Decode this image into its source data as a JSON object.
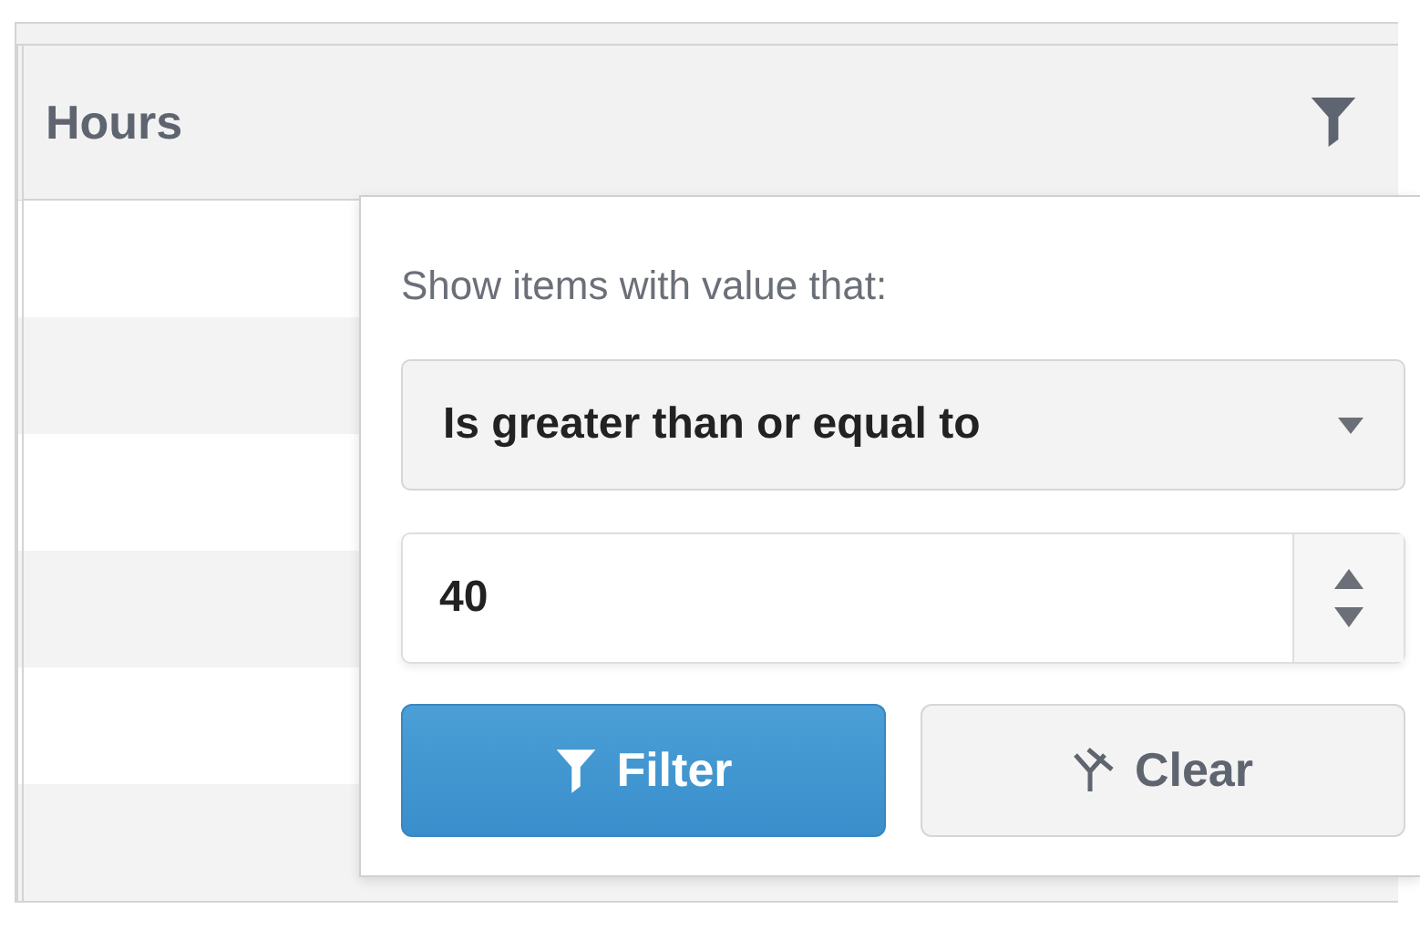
{
  "column": {
    "header": "Hours"
  },
  "filter_menu": {
    "prompt": "Show items with value that:",
    "operator": "Is greater than or equal to",
    "value": "40",
    "buttons": [
      {
        "label": "Filter",
        "kind": "primary"
      },
      {
        "label": "Clear",
        "kind": "secondary"
      }
    ]
  }
}
